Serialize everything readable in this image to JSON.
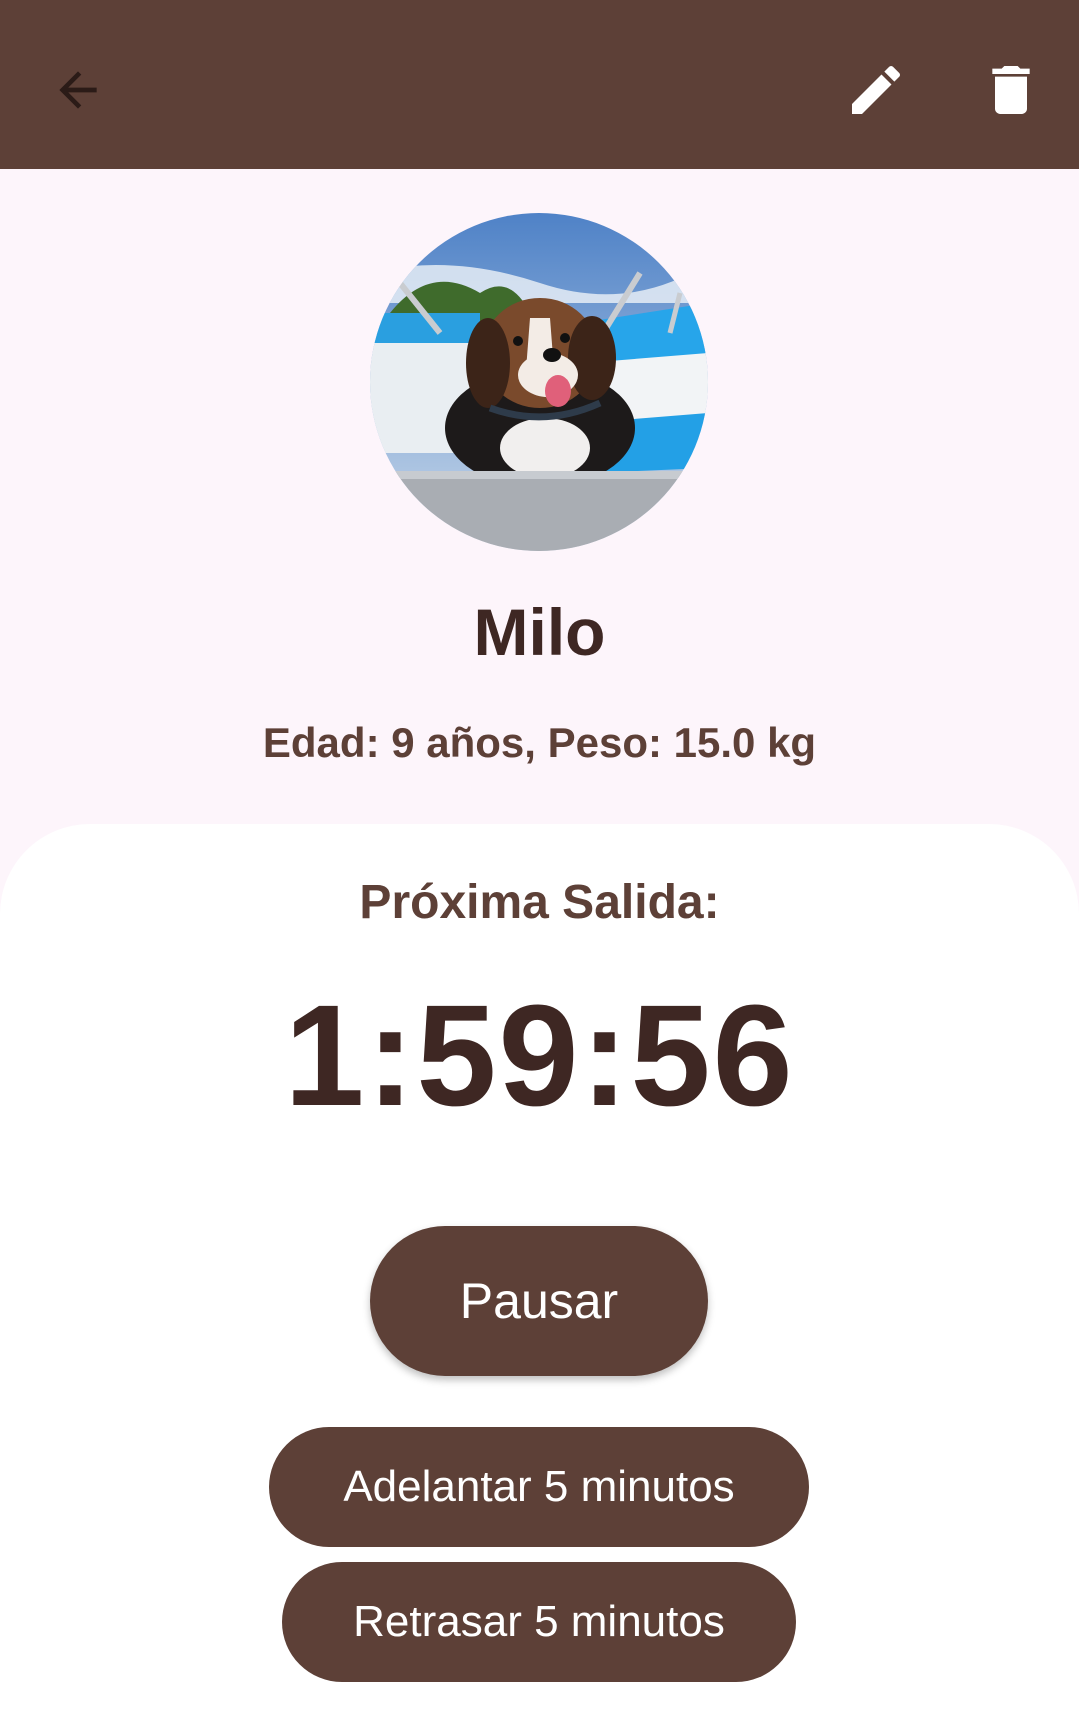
{
  "appbar": {
    "back_icon": "arrow-back-icon",
    "edit_icon": "pencil-icon",
    "delete_icon": "trash-icon",
    "background_color": "#5d4037"
  },
  "pet": {
    "name": "Milo",
    "info": "Edad: 9 años, Peso: 15.0 kg",
    "photo": "dog-on-boat-photo"
  },
  "timer": {
    "label": "Próxima Salida:",
    "value": "1:59:56"
  },
  "actions": {
    "pause_label": "Pausar",
    "forward_label": "Adelantar 5 minutos",
    "delay_label": "Retrasar 5 minutos"
  },
  "colors": {
    "primary": "#5d4037",
    "text_dark": "#3e2723",
    "background": "#fdf5fb",
    "card": "#ffffff"
  }
}
